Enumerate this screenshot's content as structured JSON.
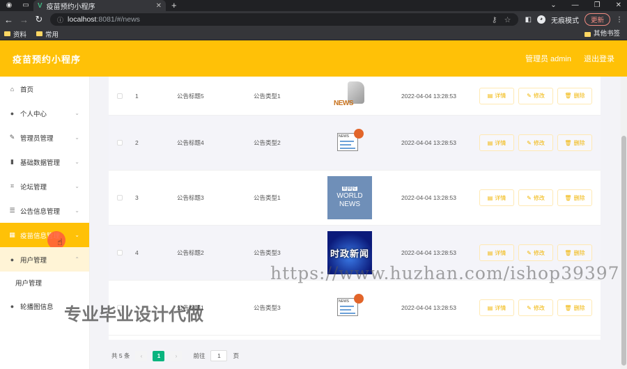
{
  "browser": {
    "tab_title": "疫苗预约小程序",
    "url_host": "localhost",
    "url_path": ":8081/#/news",
    "incognito_label": "无痕模式",
    "update_label": "更新",
    "bookmarks": [
      "资料",
      "常用"
    ],
    "bookmarks_right": "其他书签"
  },
  "header": {
    "title": "疫苗预约小程序",
    "user_label": "管理员 admin",
    "logout_label": "退出登录"
  },
  "sidebar": {
    "items": [
      {
        "label": "首页",
        "icon": "home-icon",
        "glyph": "⌂",
        "arrow": false
      },
      {
        "label": "个人中心",
        "icon": "user-icon",
        "glyph": "●",
        "arrow": true
      },
      {
        "label": "管理员管理",
        "icon": "edit-icon",
        "glyph": "✎",
        "arrow": true
      },
      {
        "label": "基础数据管理",
        "icon": "bar-chart-icon",
        "glyph": "▮",
        "arrow": true
      },
      {
        "label": "论坛管理",
        "icon": "crop-icon",
        "glyph": "⌗",
        "arrow": true
      },
      {
        "label": "公告信息管理",
        "icon": "list-icon",
        "glyph": "☰",
        "arrow": true
      },
      {
        "label": "疫苗信息管理",
        "icon": "grid-icon",
        "glyph": "▦",
        "arrow": true
      },
      {
        "label": "用户管理",
        "icon": "user-icon",
        "glyph": "●",
        "arrow": true
      }
    ],
    "submenu": [
      "用户管理"
    ],
    "last_item": {
      "label": "轮播图信息",
      "icon": "user-icon",
      "glyph": "●"
    }
  },
  "table": {
    "rows": [
      {
        "index": "1",
        "title": "公告标题5",
        "type": "公告类型1",
        "image": "news-3d-image",
        "time": "2022-04-04 13:28:53"
      },
      {
        "index": "2",
        "title": "公告标题4",
        "type": "公告类型2",
        "image": "news-icon-image",
        "time": "2022-04-04 13:28:53"
      },
      {
        "index": "3",
        "title": "公告标题3",
        "type": "公告类型1",
        "image": "bbc-world-news-image",
        "time": "2022-04-04 13:28:53"
      },
      {
        "index": "4",
        "title": "公告标题2",
        "type": "公告类型3",
        "image": "shizheng-news-image",
        "time": "2022-04-04 13:28:53"
      },
      {
        "index": "",
        "title": "公告标题1",
        "type": "公告类型3",
        "image": "news-icon-image",
        "time": "2022-04-04 13:28:53"
      }
    ],
    "actions": {
      "detail": "详情",
      "edit": "修改",
      "delete": "删除"
    }
  },
  "images": {
    "news3d_word": "NEWS",
    "newsico_word": "NEWS",
    "bbc_letters": [
      "B",
      "B",
      "C"
    ],
    "bbc_lines": [
      "WORLD",
      "NEWS"
    ],
    "shizheng": "时政新闻"
  },
  "pagination": {
    "total_label": "共 5 条",
    "prev": "‹",
    "current_page": "1",
    "next": "›",
    "goto_label": "前往",
    "goto_value": "1",
    "page_suffix": "页"
  },
  "watermarks": {
    "url": "https://www.huzhan.com/ishop39397",
    "text": "专业毕业设计代做"
  },
  "colors": {
    "accent": "#ffc107",
    "page_active": "#09b47f"
  }
}
